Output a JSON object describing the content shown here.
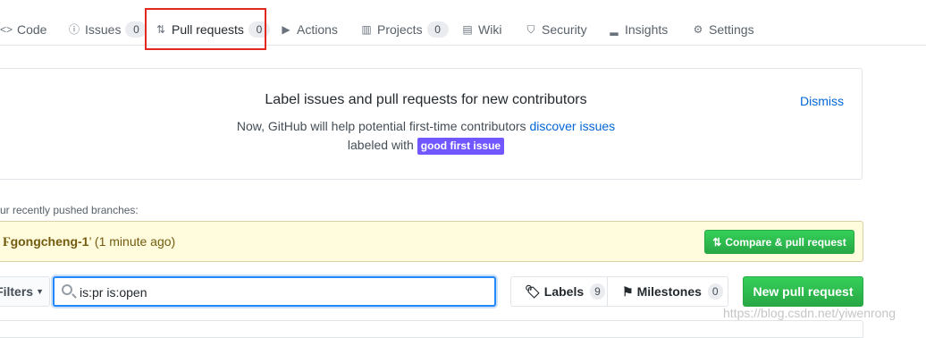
{
  "tabs": [
    {
      "icon": "code-icon",
      "glyph": "<>",
      "label": "Code"
    },
    {
      "icon": "issue-icon",
      "glyph": "ⓘ",
      "label": "Issues",
      "count": "0"
    },
    {
      "icon": "pull-request-icon",
      "glyph": "⇅",
      "label": "Pull requests",
      "count": "0"
    },
    {
      "icon": "play-icon",
      "glyph": "▶",
      "label": "Actions"
    },
    {
      "icon": "project-icon",
      "glyph": "▥",
      "label": "Projects",
      "count": "0"
    },
    {
      "icon": "book-icon",
      "glyph": "▤",
      "label": "Wiki"
    },
    {
      "icon": "shield-icon",
      "glyph": "⛉",
      "label": "Security"
    },
    {
      "icon": "graph-icon",
      "glyph": "▂",
      "label": "Insights"
    },
    {
      "icon": "gear-icon",
      "glyph": "⚙",
      "label": "Settings"
    }
  ],
  "banner": {
    "title": "Label issues and pull requests for new contributors",
    "line1_prefix": "Now, GitHub will help potential first-time contributors ",
    "line1_link": "discover issues",
    "line2_prefix": "labeled with ",
    "label": "good first issue",
    "label_color": "#7057ff",
    "dismiss": "Dismiss"
  },
  "recent": {
    "title": "ur recently pushed branches:",
    "branch": "gongcheng-1",
    "suffix": "’ (1 minute ago)",
    "compare_label": "Compare & pull request"
  },
  "toolbar": {
    "filters_label": "Filters",
    "search_value": "is:pr is:open",
    "labels_label": "Labels",
    "labels_count": "9",
    "milestones_label": "Milestones",
    "milestones_count": "0",
    "new_pr_label": "New pull request"
  },
  "watermark": "https://blog.csdn.net/yiwenrong",
  "colors": {
    "accent_green": "#28a745",
    "link_blue": "#0366d6",
    "highlight_red": "#e1291f"
  }
}
